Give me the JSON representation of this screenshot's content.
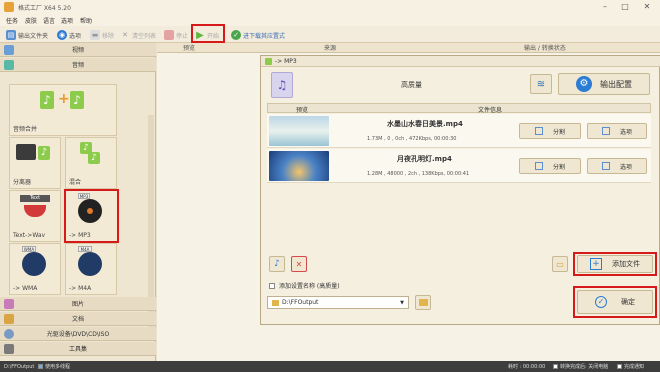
{
  "app": {
    "title": "格式工厂 X64 5.20"
  },
  "menu": [
    "任务",
    "皮肤",
    "语言",
    "选项",
    "帮助"
  ],
  "toolbar": {
    "output_folder": "输出文件夹",
    "options": "选项",
    "remove": "移除",
    "clear": "清空列表",
    "stop": "停止",
    "start": "开始",
    "after_done": "进下载其应置式"
  },
  "sidebar": {
    "categories": {
      "video": "视频",
      "audio": "音频",
      "picture": "图片",
      "document": "文档",
      "rom": "光驱设备\\DVD\\CD\\ISO",
      "tools": "工具集"
    },
    "tiles": [
      "音频合并",
      "分离器",
      "混合",
      "Text->Wav",
      "-> MP3",
      "-> WMA",
      "-> M4A"
    ],
    "tile_badges": {
      "mp3": "MP3",
      "wma": "WMA",
      "m4a": "M4A",
      "text": "Text"
    }
  },
  "main": {
    "columns": [
      "预览",
      "来源",
      "输出 / 转换状态"
    ]
  },
  "dialog": {
    "title": "-> MP3",
    "quality": "高质量",
    "output_config": "输出配置",
    "table_headers": [
      "预览",
      "文件信息"
    ],
    "files": [
      {
        "name": "水墨山水春日美景.mp4",
        "meta": "1.73M , 0 , 0ch , 472Kbps, 00:00:30",
        "split": "分割",
        "option": "选项"
      },
      {
        "name": "月夜孔明灯.mp4",
        "meta": "1.28M , 48000 , 2ch , 138Kbps, 00:00:41",
        "split": "分割",
        "option": "选项"
      }
    ],
    "add_file": "添加文件",
    "add_setting_name": "添加设置名称 (高质量)",
    "output_path": "D:\\FFOutput",
    "ok": "确定"
  },
  "status": {
    "output_path": "D:\\FFOutput",
    "multithread": "使用多线程",
    "elapsed": "耗时 : 00:00:00",
    "shutdown": "转换完成后: 关闭电脑",
    "notify": "完成通知"
  },
  "colors": {
    "highlight": "#d81919",
    "bg": "#ece2cb",
    "dialog": "#f5efdf",
    "accent_blue": "#2b7cd3"
  }
}
